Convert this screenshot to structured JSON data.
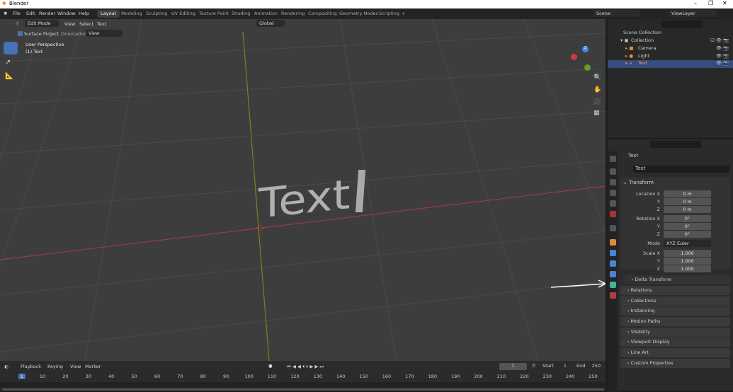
{
  "window": {
    "title": "Blender"
  },
  "menu": [
    "File",
    "Edit",
    "Render",
    "Window",
    "Help"
  ],
  "workspaces": [
    "Layout",
    "Modeling",
    "Sculpting",
    "UV Editing",
    "Texture Paint",
    "Shading",
    "Animation",
    "Rendering",
    "Compositing",
    "Geometry Nodes",
    "Scripting",
    "+"
  ],
  "scene": {
    "name": "Scene",
    "view_layer": "ViewLayer"
  },
  "viewport": {
    "mode": "Edit Mode",
    "menus": [
      "View",
      "Select",
      "Text"
    ],
    "orientation_global": "Global",
    "surface_project": "Surface Project",
    "orientation_label": "Orientation:",
    "orientation_value": "View",
    "overlay_title": "User Perspective",
    "overlay_sub": "(1) Text",
    "object_text": "Text",
    "gizmo": {
      "x": "X",
      "y": "Y",
      "z": "Z"
    }
  },
  "outliner": {
    "items": [
      {
        "label": "Scene Collection"
      },
      {
        "label": "Collection"
      },
      {
        "label": "Camera"
      },
      {
        "label": "Light"
      },
      {
        "label": "Text"
      }
    ]
  },
  "properties": {
    "object_name": "Text",
    "data_name": "Text",
    "transform_label": "Transform",
    "location": {
      "label": "Location X",
      "x": "0 m",
      "y": "0 m",
      "z": "0 m"
    },
    "rotation": {
      "label": "Rotation X",
      "x": "0°",
      "y": "0°",
      "z": "0°"
    },
    "mode": {
      "label": "Mode",
      "value": "XYZ Euler"
    },
    "scale": {
      "label": "Scale X",
      "x": "1.000",
      "y": "1.000",
      "z": "1.000"
    },
    "axis": {
      "y": "Y",
      "z": "Z"
    },
    "panels": [
      "Delta Transform",
      "Relations",
      "Collections",
      "Instancing",
      "Motion Paths",
      "Visibility",
      "Viewport Display",
      "Line Art",
      "Custom Properties"
    ]
  },
  "timeline": {
    "menus": [
      "Playback",
      "Keying",
      "View",
      "Marker"
    ],
    "current_frame": "1",
    "start_label": "Start",
    "start": "1",
    "end_label": "End",
    "end": "250",
    "ticks": [
      "1",
      "10",
      "20",
      "30",
      "40",
      "50",
      "60",
      "70",
      "80",
      "90",
      "100",
      "110",
      "120",
      "130",
      "140",
      "150",
      "160",
      "170",
      "180",
      "190",
      "200",
      "210",
      "220",
      "230",
      "240",
      "250"
    ]
  }
}
